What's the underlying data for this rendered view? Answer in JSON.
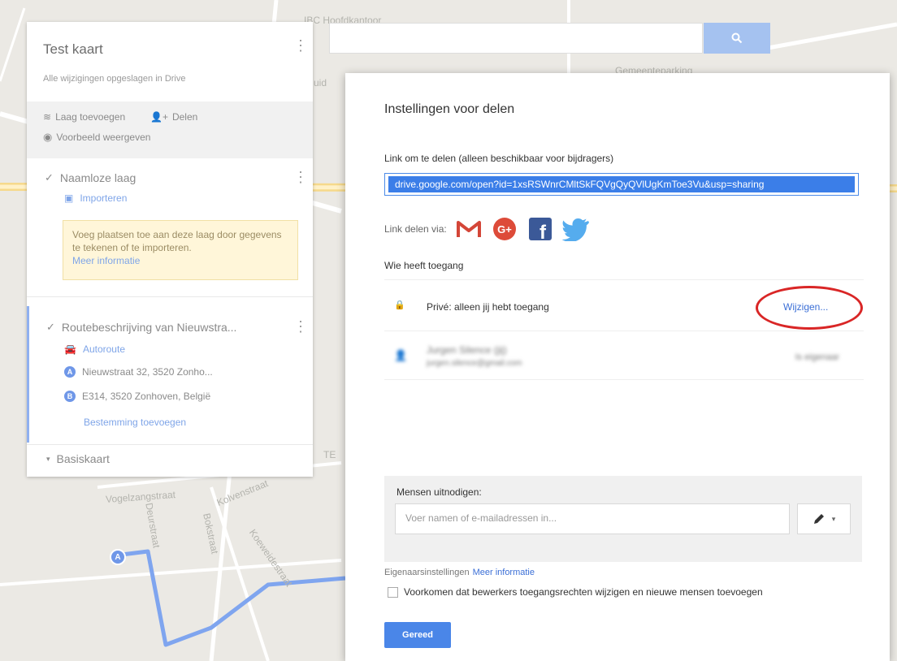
{
  "map": {
    "labels": {
      "top": "IBC Hoofdkantoor",
      "right": "Gemeenteparking",
      "street1": "Vogelzangstraat",
      "street2": "Kolvenstraat",
      "street3": "Deurstraat",
      "street4": "Bokstraat",
      "street5": "Koeweidestraat",
      "partial": "uid",
      "te": "TE"
    },
    "route_color": "#7fa5ef"
  },
  "panel": {
    "title": "Test kaart",
    "subtitle": "Alle wijzigingen opgeslagen in Drive",
    "actions": {
      "add_layer": "Laag toevoegen",
      "share": "Delen",
      "preview": "Voorbeeld weergeven"
    },
    "layer1": {
      "name": "Naamloze laag",
      "import": "Importeren",
      "hint": "Voeg plaatsen toe aan deze laag door gegevens te tekenen of te importeren.",
      "hint_link": "Meer informatie"
    },
    "layer2": {
      "name": "Routebeschrijving van Nieuwstra...",
      "mode": "Autoroute",
      "stop_a_letter": "A",
      "stop_a": "Nieuwstraat 32, 3520 Zonho...",
      "stop_b_letter": "B",
      "stop_b": "E314, 3520 Zonhoven, België",
      "add_destination": "Bestemming toevoegen"
    },
    "basemap": "Basiskaart"
  },
  "dialog": {
    "title": "Instellingen voor delen",
    "link_label": "Link om te delen (alleen beschikbaar voor bijdragers)",
    "link_value": "drive.google.com/open?id=1xsRSWnrCMltSkFQVgQyQVlUgKmToe3Vu&usp=sharing",
    "share_via": "Link delen via:",
    "who_access": "Wie heeft toegang",
    "private_text": "Privé: alleen jij hebt toegang",
    "change_link": "Wijzigen...",
    "user_name": "Jurgen Silence (jij)",
    "user_email": "jurgen.silence@gmail.com",
    "user_role": "Is eigenaar",
    "invite_label": "Mensen uitnodigen:",
    "invite_placeholder": "Voer namen of e-mailadressen in...",
    "owner_settings": "Eigenaarsinstellingen",
    "owner_more": "Meer informatie",
    "prevent_text": "Voorkomen dat bewerkers toegangsrechten wijzigen en nieuwe mensen toevoegen",
    "done_button": "Gereed"
  },
  "colors": {
    "accent": "#4a86e8",
    "highlight_oval": "#d92626"
  }
}
